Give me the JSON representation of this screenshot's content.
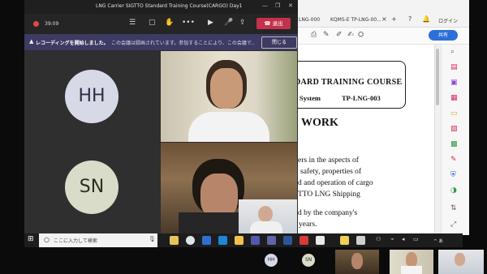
{
  "pdf": {
    "tab1": "LNG-000",
    "tab2": "KQMS-E TP-LNG-00...",
    "login": "ログイン",
    "share_label": "共有",
    "doc": {
      "course": "DARD TRAINING COURSE",
      "system": "System",
      "code": "TP-LNG-003",
      "heading": "WORK",
      "lines": [
        "ers in the aspects of",
        "safety, properties of",
        "d and operation of cargo",
        "TTO LNG Shipping",
        "d by the company's",
        "years."
      ]
    }
  },
  "teams": {
    "window_title": "LNG Carrier SIGTTO Standard Training Course(CARGO) Day1",
    "timer": "39:09",
    "leave_label": "退出",
    "notice_bold": "レコーディングを開始しました。",
    "notice_text": "この会議は録画されています。参加することにより、この会議で...",
    "close_label": "閉じる"
  },
  "participants": {
    "p1_initials": "HH",
    "p2_initials": "SN"
  },
  "taskbar": {
    "search_placeholder": "ここに入力して検索",
    "tray": "^ あ"
  },
  "colors": {
    "leave": "#c4314b",
    "notice_bar": "#3d3a63",
    "share": "#2b6fd8"
  }
}
